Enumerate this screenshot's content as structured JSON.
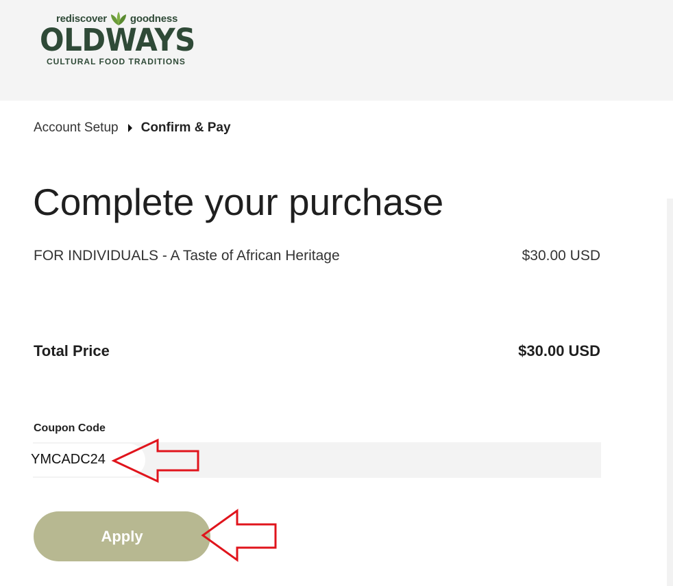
{
  "header": {
    "logo": {
      "tagline_left": "rediscover",
      "tagline_right": "goodness",
      "brand": "OLDWAYS",
      "subtitle": "CULTURAL FOOD TRADITIONS"
    }
  },
  "breadcrumb": {
    "step1": "Account Setup",
    "step2": "Confirm & Pay"
  },
  "main": {
    "title": "Complete your purchase",
    "line_item": {
      "name": "FOR INDIVIDUALS - A Taste of African Heritage",
      "price": "$30.00 USD"
    },
    "total": {
      "label": "Total Price",
      "value": "$30.00 USD"
    },
    "coupon": {
      "label": "Coupon Code",
      "value": "YMCADC24"
    },
    "apply_label": "Apply"
  },
  "colors": {
    "brand_green": "#2f4a37",
    "leaf_green": "#6a9a3a",
    "header_bg": "#f4f4f4",
    "apply_button": "#b7b891",
    "annotation_arrow": "#e0141c"
  }
}
